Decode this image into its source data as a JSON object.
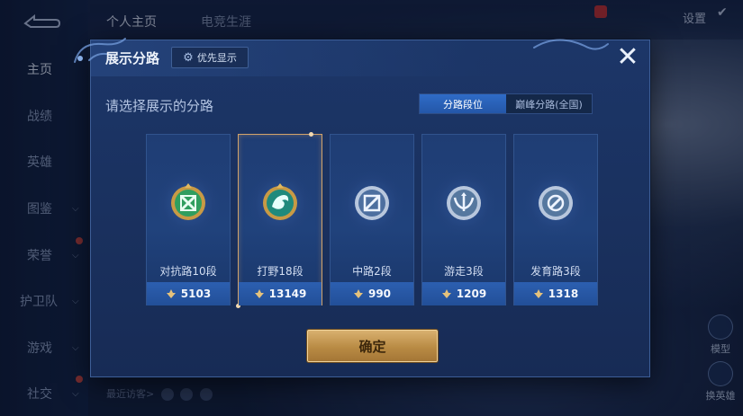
{
  "background": {
    "nav_items": [
      {
        "label": "主页",
        "active": true,
        "chevron": false
      },
      {
        "label": "战绩",
        "active": false,
        "chevron": false
      },
      {
        "label": "英雄",
        "active": false,
        "chevron": false
      },
      {
        "label": "图鉴",
        "active": false,
        "chevron": true
      },
      {
        "label": "荣誉",
        "active": false,
        "chevron": true
      },
      {
        "label": "护卫队",
        "active": false,
        "chevron": true
      },
      {
        "label": "游戏",
        "active": false,
        "chevron": true
      },
      {
        "label": "社交",
        "active": false,
        "chevron": true
      }
    ],
    "top_tabs": [
      {
        "label": "个人主页",
        "active": true
      },
      {
        "label": "电竞生涯",
        "active": false
      }
    ],
    "settings_label": "设置",
    "recent_visitors_label": "最近访客>",
    "right_buttons": [
      {
        "label": "模型"
      },
      {
        "label": "换英雄"
      }
    ]
  },
  "modal": {
    "title": "展示分路",
    "priority_button": "优先显示",
    "subtitle": "请选择展示的分路",
    "toggle": {
      "options": [
        "分路段位",
        "巅峰分路(全国)"
      ],
      "selected": 0
    },
    "lanes": [
      {
        "name": "对抗路10段",
        "points": "5103",
        "icon": "clash-lane-emblem-icon",
        "color": "#3fae6a",
        "selected": false
      },
      {
        "name": "打野18段",
        "points": "13149",
        "icon": "jungle-emblem-icon",
        "color": "#2a9e8a",
        "selected": true
      },
      {
        "name": "中路2段",
        "points": "990",
        "icon": "mid-lane-emblem-icon",
        "color": "#6f8fb8",
        "selected": false
      },
      {
        "name": "游走3段",
        "points": "1209",
        "icon": "roam-emblem-icon",
        "color": "#7a98c2",
        "selected": false
      },
      {
        "name": "发育路3段",
        "points": "1318",
        "icon": "farm-lane-emblem-icon",
        "color": "#7a98c2",
        "selected": false
      }
    ],
    "confirm_label": "确定"
  },
  "colors": {
    "modal_bg": "#1c3668",
    "accent_blue": "#2f6cc7",
    "gold": "#d2a36a",
    "confirm_gold": "#c49a55"
  }
}
